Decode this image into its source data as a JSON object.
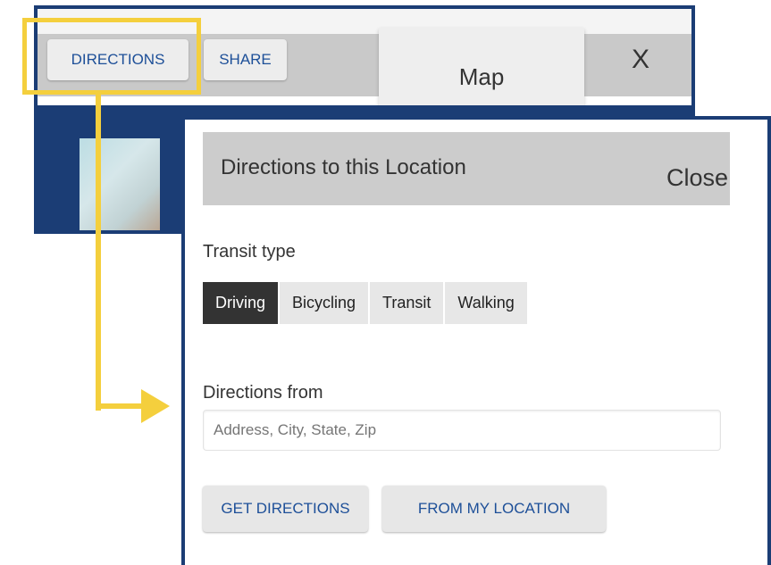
{
  "map_panel": {
    "directions_label": "DIRECTIONS",
    "share_label": "SHARE",
    "map_tab_label": "Map",
    "close_label": "X"
  },
  "directions_panel": {
    "title": "Directions to this Location",
    "close_label": "Close",
    "transit_label": "Transit type",
    "transit_options": [
      "Driving",
      "Bicycling",
      "Transit",
      "Walking"
    ],
    "transit_selected": "Driving",
    "from_label": "Directions from",
    "address_placeholder": "Address, City, State, Zip",
    "get_directions_label": "GET DIRECTIONS",
    "from_location_label": "FROM MY LOCATION"
  },
  "colors": {
    "frame_blue": "#1b3d75",
    "highlight_yellow": "#f4cf3d",
    "link_blue": "#1d4f98",
    "active_segment": "#333333"
  }
}
